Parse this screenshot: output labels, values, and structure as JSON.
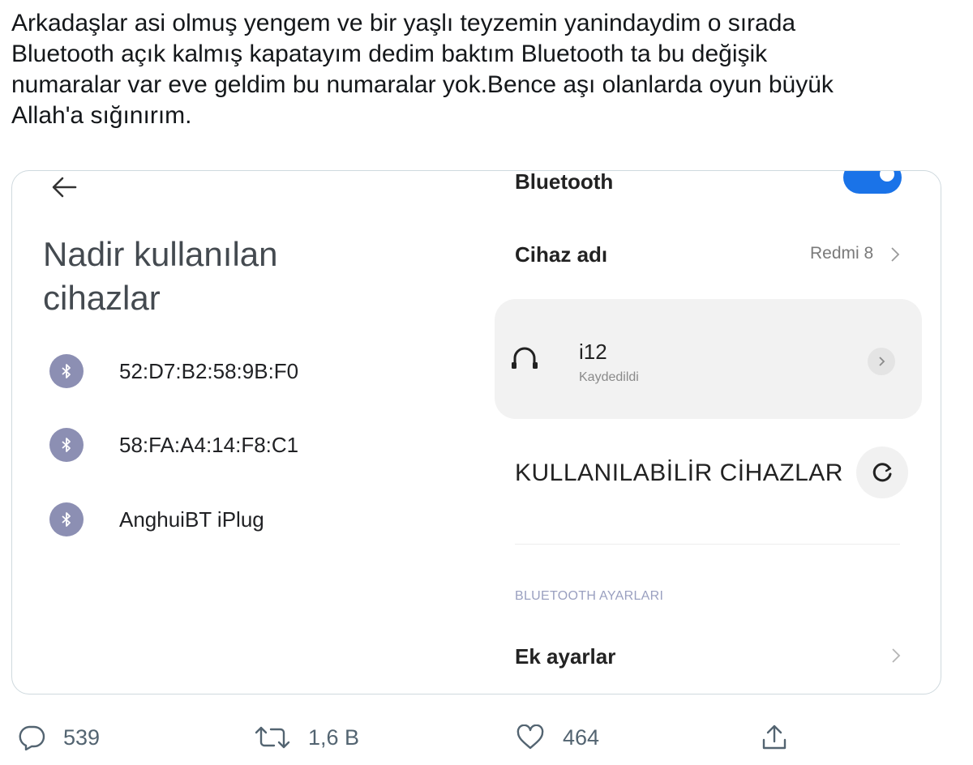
{
  "tweet": {
    "text": "Arkadaşlar asi olmuş yengem ve bir yaşlı teyzemin yanindaydim o sırada\nBluetooth açık kalmış kapatayım dedim baktım Bluetooth ta bu değişik\nnumaralar var eve geldim bu numaralar yok.Bence aşı olanlarda oyun büyük\nAllah'a sığınırım."
  },
  "screenshot_left": {
    "back_icon": "arrow-left-icon",
    "title": "Nadir kullanılan cihazlar",
    "devices": [
      {
        "icon": "bluetooth-icon",
        "label": "52:D7:B2:58:9B:F0"
      },
      {
        "icon": "bluetooth-icon",
        "label": "58:FA:A4:14:F8:C1"
      },
      {
        "icon": "bluetooth-icon",
        "label": "AnghuiBT iPlug"
      }
    ]
  },
  "screenshot_right": {
    "bluetooth_label": "Bluetooth",
    "toggle_on": true,
    "device_name_label": "Cihaz adı",
    "device_name_value": "Redmi 8",
    "saved_device": {
      "icon": "headphones-icon",
      "name": "i12",
      "status": "Kaydedildi"
    },
    "available_title": "KULLANILABİLİR CİHAZLAR",
    "section_label": "BLUETOOTH AYARLARI",
    "extra_settings": "Ek ayarlar"
  },
  "actions": {
    "reply_count": "539",
    "retweet_count": "1,6 B",
    "like_count": "464"
  },
  "colors": {
    "accent": "#1a73e8",
    "bt_circle": "#8c8fb3",
    "action_gray": "#536471"
  }
}
